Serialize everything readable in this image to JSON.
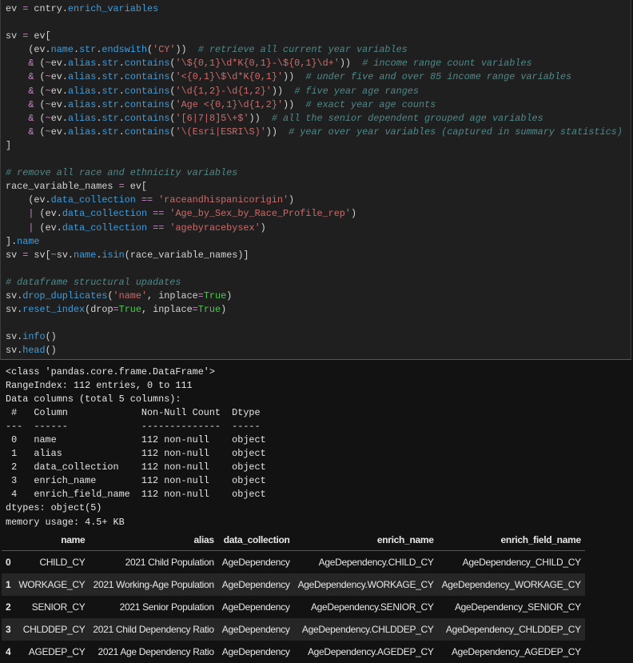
{
  "code_lines": [
    [
      [
        "txt",
        "ev "
      ],
      [
        "op",
        "="
      ],
      [
        "txt",
        " cntry."
      ],
      [
        "attr",
        "enrich_variables"
      ]
    ],
    [],
    [
      [
        "txt",
        "sv "
      ],
      [
        "op",
        "="
      ],
      [
        "txt",
        " ev["
      ]
    ],
    [
      [
        "txt",
        "    (ev."
      ],
      [
        "attr",
        "name"
      ],
      [
        "txt",
        "."
      ],
      [
        "attr",
        "str"
      ],
      [
        "txt",
        "."
      ],
      [
        "attr",
        "endswith"
      ],
      [
        "txt",
        "("
      ],
      [
        "str",
        "'CY'"
      ],
      [
        "txt",
        "))  "
      ],
      [
        "com",
        "# retrieve all current year variables"
      ]
    ],
    [
      [
        "txt",
        "    "
      ],
      [
        "op",
        "&"
      ],
      [
        "txt",
        " ("
      ],
      [
        "op",
        "~"
      ],
      [
        "txt",
        "ev."
      ],
      [
        "attr",
        "alias"
      ],
      [
        "txt",
        "."
      ],
      [
        "attr",
        "str"
      ],
      [
        "txt",
        "."
      ],
      [
        "attr",
        "contains"
      ],
      [
        "txt",
        "("
      ],
      [
        "str",
        "'\\${0,1}\\d*K{0,1}-\\${0,1}\\d+'"
      ],
      [
        "txt",
        "))  "
      ],
      [
        "com",
        "# income range count variables"
      ]
    ],
    [
      [
        "txt",
        "    "
      ],
      [
        "op",
        "&"
      ],
      [
        "txt",
        " ("
      ],
      [
        "op",
        "~"
      ],
      [
        "txt",
        "ev."
      ],
      [
        "attr",
        "alias"
      ],
      [
        "txt",
        "."
      ],
      [
        "attr",
        "str"
      ],
      [
        "txt",
        "."
      ],
      [
        "attr",
        "contains"
      ],
      [
        "txt",
        "("
      ],
      [
        "str",
        "'<{0,1}\\$\\d*K{0,1}'"
      ],
      [
        "txt",
        "))  "
      ],
      [
        "com",
        "# under five and over 85 income range variables"
      ]
    ],
    [
      [
        "txt",
        "    "
      ],
      [
        "op",
        "&"
      ],
      [
        "txt",
        " ("
      ],
      [
        "op",
        "~"
      ],
      [
        "txt",
        "ev."
      ],
      [
        "attr",
        "alias"
      ],
      [
        "txt",
        "."
      ],
      [
        "attr",
        "str"
      ],
      [
        "txt",
        "."
      ],
      [
        "attr",
        "contains"
      ],
      [
        "txt",
        "("
      ],
      [
        "str",
        "'\\d{1,2}-\\d{1,2}'"
      ],
      [
        "txt",
        "))  "
      ],
      [
        "com",
        "# five year age ranges"
      ]
    ],
    [
      [
        "txt",
        "    "
      ],
      [
        "op",
        "&"
      ],
      [
        "txt",
        " ("
      ],
      [
        "op",
        "~"
      ],
      [
        "txt",
        "ev."
      ],
      [
        "attr",
        "alias"
      ],
      [
        "txt",
        "."
      ],
      [
        "attr",
        "str"
      ],
      [
        "txt",
        "."
      ],
      [
        "attr",
        "contains"
      ],
      [
        "txt",
        "("
      ],
      [
        "str",
        "'Age <{0,1}\\d{1,2}'"
      ],
      [
        "txt",
        "))  "
      ],
      [
        "com",
        "# exact year age counts"
      ]
    ],
    [
      [
        "txt",
        "    "
      ],
      [
        "op",
        "&"
      ],
      [
        "txt",
        " ("
      ],
      [
        "op",
        "~"
      ],
      [
        "txt",
        "ev."
      ],
      [
        "attr",
        "alias"
      ],
      [
        "txt",
        "."
      ],
      [
        "attr",
        "str"
      ],
      [
        "txt",
        "."
      ],
      [
        "attr",
        "contains"
      ],
      [
        "txt",
        "("
      ],
      [
        "str",
        "'[6|7|8]5\\+$'"
      ],
      [
        "txt",
        "))  "
      ],
      [
        "com",
        "# all the senior dependent grouped age variables"
      ]
    ],
    [
      [
        "txt",
        "    "
      ],
      [
        "op",
        "&"
      ],
      [
        "txt",
        " ("
      ],
      [
        "op",
        "~"
      ],
      [
        "txt",
        "ev."
      ],
      [
        "attr",
        "alias"
      ],
      [
        "txt",
        "."
      ],
      [
        "attr",
        "str"
      ],
      [
        "txt",
        "."
      ],
      [
        "attr",
        "contains"
      ],
      [
        "txt",
        "("
      ],
      [
        "str",
        "'\\(Esri|ESRI\\S)'"
      ],
      [
        "txt",
        "))  "
      ],
      [
        "com",
        "# year over year variables (captured in summary statistics)"
      ]
    ],
    [
      [
        "txt",
        "]"
      ]
    ],
    [],
    [
      [
        "com",
        "# remove all race and ethnicity variables"
      ]
    ],
    [
      [
        "txt",
        "race_variable_names "
      ],
      [
        "op",
        "="
      ],
      [
        "txt",
        " ev["
      ]
    ],
    [
      [
        "txt",
        "    (ev."
      ],
      [
        "attr",
        "data_collection"
      ],
      [
        "txt",
        " "
      ],
      [
        "op",
        "=="
      ],
      [
        "txt",
        " "
      ],
      [
        "str",
        "'raceandhispanicorigin'"
      ],
      [
        "txt",
        ")"
      ]
    ],
    [
      [
        "txt",
        "    "
      ],
      [
        "op",
        "|"
      ],
      [
        "txt",
        " (ev."
      ],
      [
        "attr",
        "data_collection"
      ],
      [
        "txt",
        " "
      ],
      [
        "op",
        "=="
      ],
      [
        "txt",
        " "
      ],
      [
        "str",
        "'Age_by_Sex_by_Race_Profile_rep'"
      ],
      [
        "txt",
        ")"
      ]
    ],
    [
      [
        "txt",
        "    "
      ],
      [
        "op",
        "|"
      ],
      [
        "txt",
        " (ev."
      ],
      [
        "attr",
        "data_collection"
      ],
      [
        "txt",
        " "
      ],
      [
        "op",
        "=="
      ],
      [
        "txt",
        " "
      ],
      [
        "str",
        "'agebyracebysex'"
      ],
      [
        "txt",
        ")"
      ]
    ],
    [
      [
        "txt",
        "]."
      ],
      [
        "attr",
        "name"
      ]
    ],
    [
      [
        "txt",
        "sv "
      ],
      [
        "op",
        "="
      ],
      [
        "txt",
        " sv["
      ],
      [
        "op",
        "~"
      ],
      [
        "txt",
        "sv."
      ],
      [
        "attr",
        "name"
      ],
      [
        "txt",
        "."
      ],
      [
        "attr",
        "isin"
      ],
      [
        "txt",
        "(race_variable_names)]"
      ]
    ],
    [],
    [
      [
        "com",
        "# dataframe structural upadates"
      ]
    ],
    [
      [
        "txt",
        "sv."
      ],
      [
        "attr",
        "drop_duplicates"
      ],
      [
        "txt",
        "("
      ],
      [
        "str",
        "'name'"
      ],
      [
        "txt",
        ", inplace"
      ],
      [
        "op",
        "="
      ],
      [
        "kw",
        "True"
      ],
      [
        "txt",
        ")"
      ]
    ],
    [
      [
        "txt",
        "sv."
      ],
      [
        "attr",
        "reset_index"
      ],
      [
        "txt",
        "(drop"
      ],
      [
        "op",
        "="
      ],
      [
        "kw",
        "True"
      ],
      [
        "txt",
        ", inplace"
      ],
      [
        "op",
        "="
      ],
      [
        "kw",
        "True"
      ],
      [
        "txt",
        ")"
      ]
    ],
    [],
    [
      [
        "txt",
        "sv."
      ],
      [
        "attr",
        "info"
      ],
      [
        "txt",
        "()"
      ]
    ],
    [
      [
        "txt",
        "sv."
      ],
      [
        "attr",
        "head"
      ],
      [
        "txt",
        "()"
      ]
    ]
  ],
  "stdout_lines": [
    "<class 'pandas.core.frame.DataFrame'>",
    "RangeIndex: 112 entries, 0 to 111",
    "Data columns (total 5 columns):",
    " #   Column             Non-Null Count  Dtype ",
    "---  ------             --------------  ----- ",
    " 0   name               112 non-null    object",
    " 1   alias              112 non-null    object",
    " 2   data_collection    112 non-null    object",
    " 3   enrich_name        112 non-null    object",
    " 4   enrich_field_name  112 non-null    object",
    "dtypes: object(5)",
    "memory usage: 4.5+ KB"
  ],
  "table": {
    "columns": [
      "",
      "name",
      "alias",
      "data_collection",
      "enrich_name",
      "enrich_field_name"
    ],
    "rows": [
      [
        "0",
        "CHILD_CY",
        "2021 Child Population",
        "AgeDependency",
        "AgeDependency.CHILD_CY",
        "AgeDependency_CHILD_CY"
      ],
      [
        "1",
        "WORKAGE_CY",
        "2021 Working-Age Population",
        "AgeDependency",
        "AgeDependency.WORKAGE_CY",
        "AgeDependency_WORKAGE_CY"
      ],
      [
        "2",
        "SENIOR_CY",
        "2021 Senior Population",
        "AgeDependency",
        "AgeDependency.SENIOR_CY",
        "AgeDependency_SENIOR_CY"
      ],
      [
        "3",
        "CHLDDEP_CY",
        "2021 Child Dependency Ratio",
        "AgeDependency",
        "AgeDependency.CHLDDEP_CY",
        "AgeDependency_CHLDDEP_CY"
      ],
      [
        "4",
        "AGEDEP_CY",
        "2021 Age Dependency Ratio",
        "AgeDependency",
        "AgeDependency.AGEDEP_CY",
        "AgeDependency_AGEDEP_CY"
      ]
    ]
  }
}
